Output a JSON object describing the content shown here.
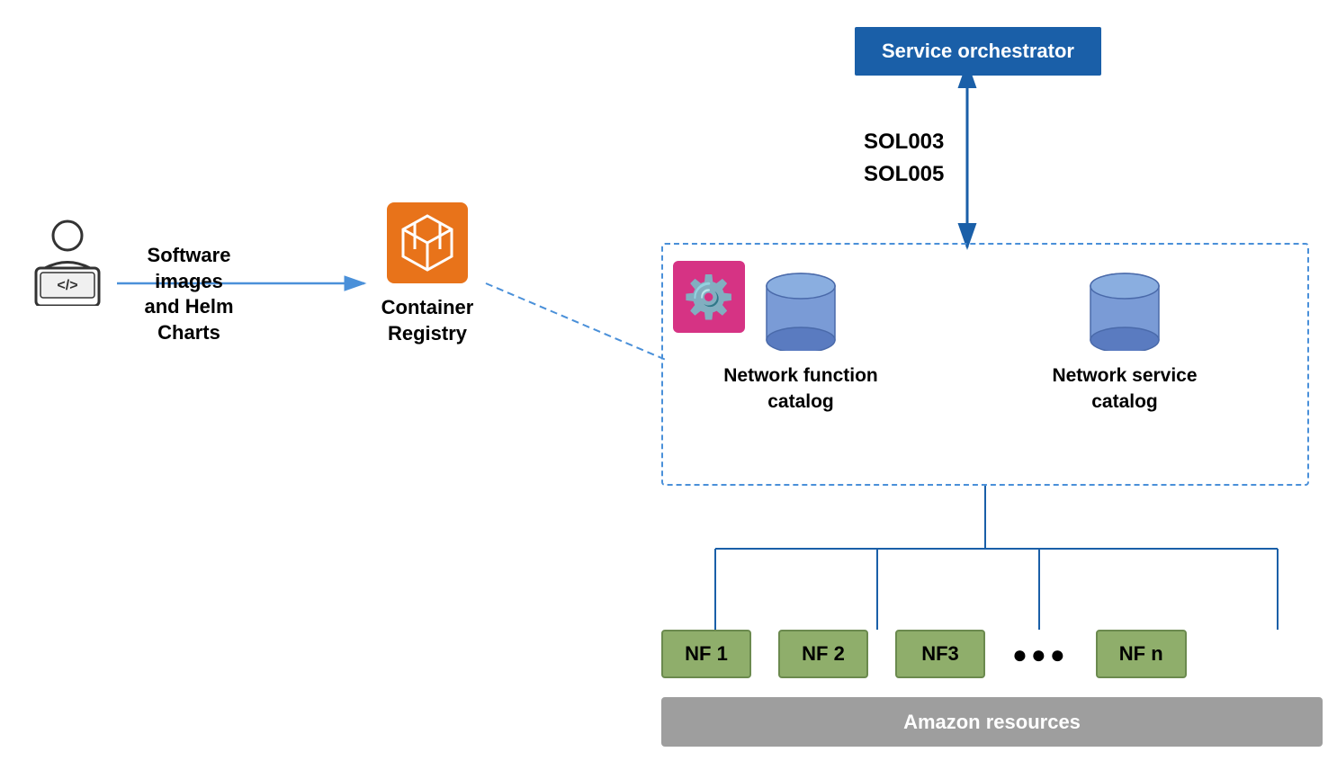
{
  "developer": {
    "label": "developer"
  },
  "software_label": {
    "line1": "Software",
    "line2": "images",
    "line3": "and Helm",
    "line4": "Charts",
    "full": "Software\nimages\nand Helm\nCharts"
  },
  "container_registry": {
    "label_line1": "Container",
    "label_line2": "Registry"
  },
  "service_orchestrator": {
    "label": "Service orchestrator"
  },
  "sol_labels": {
    "sol1": "SOL003",
    "sol2": "SOL005"
  },
  "nf_catalog": {
    "label": "Network function\ncatalog"
  },
  "ns_catalog": {
    "label": "Network service\ncatalog"
  },
  "nf_nodes": [
    {
      "label": "NF 1"
    },
    {
      "label": "NF 2"
    },
    {
      "label": "NF3"
    },
    {
      "label": "NF n"
    }
  ],
  "amazon_resources": {
    "label": "Amazon resources"
  },
  "colors": {
    "blue": "#1a5fa8",
    "arrow_blue": "#4a90d9",
    "nf_green": "#8fae6b",
    "pink": "#d63384",
    "gray": "#9e9e9e"
  }
}
